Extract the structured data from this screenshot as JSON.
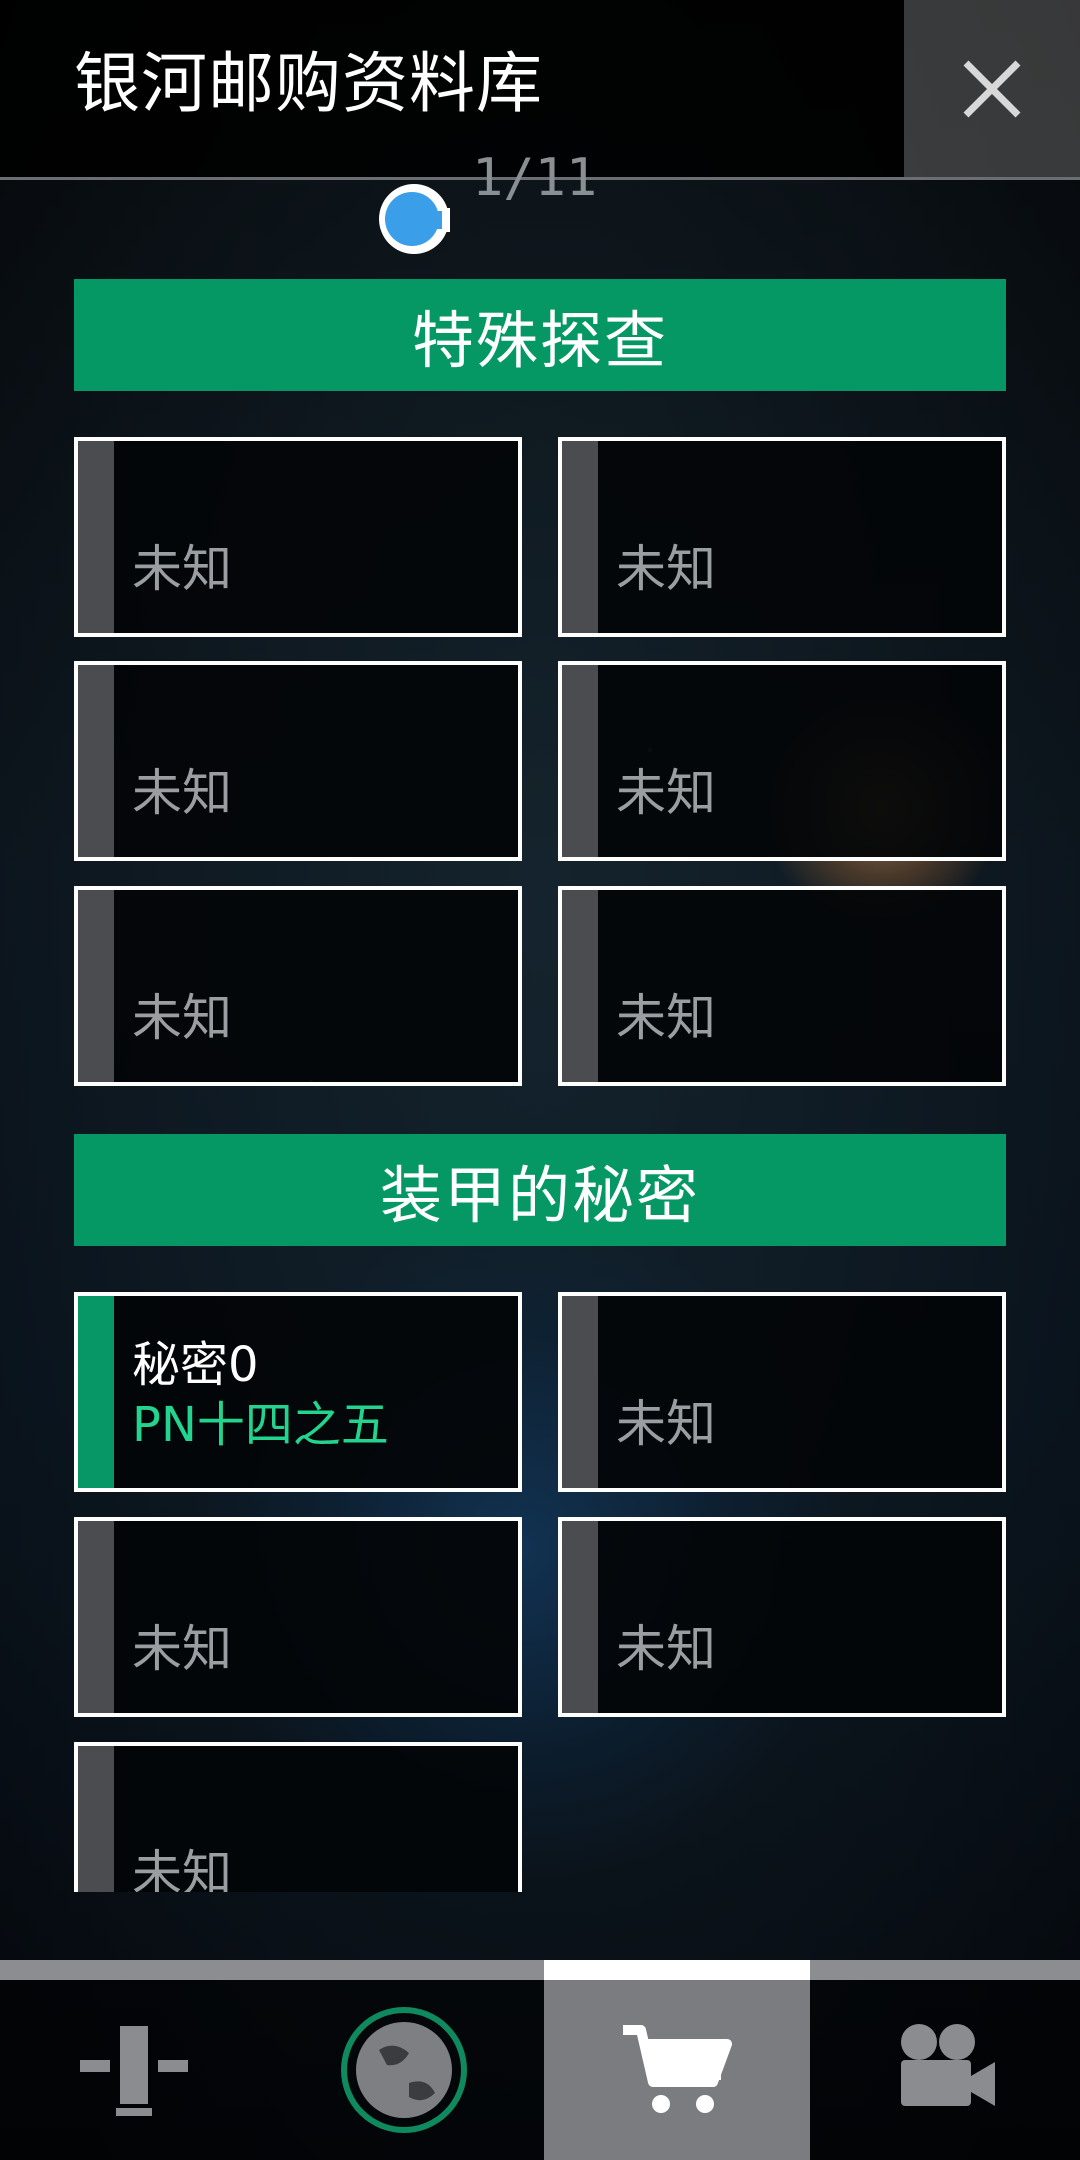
{
  "header": {
    "title": "银河邮购资料库",
    "close_icon": "close-icon",
    "page_indicator": "1/11",
    "progress_icon": "progress-disc-icon",
    "accent_color": "#3a9ee8"
  },
  "sections": [
    {
      "title": "特殊探查",
      "cards": [
        {
          "label": "未知"
        },
        {
          "label": "未知"
        },
        {
          "label": "未知"
        },
        {
          "label": "未知"
        },
        {
          "label": "未知"
        },
        {
          "label": "未知"
        }
      ]
    },
    {
      "title": "装甲的秘密",
      "cards": [
        {
          "name": "秘密0",
          "subtitle": "PN十四之五",
          "unlocked": true
        },
        {
          "label": "未知"
        },
        {
          "label": "未知"
        },
        {
          "label": "未知"
        },
        {
          "label": "未知"
        }
      ]
    }
  ],
  "bottom_nav": {
    "tabs": [
      {
        "icon": "tower-icon"
      },
      {
        "icon": "planet-icon"
      },
      {
        "icon": "cart-icon",
        "active": true
      },
      {
        "icon": "video-camera-icon"
      }
    ]
  },
  "colors": {
    "section_green": "#059764",
    "unlocked_strip": "#079766",
    "subtitle_green": "#22d48d",
    "locked_strip": "#4a4c50"
  }
}
